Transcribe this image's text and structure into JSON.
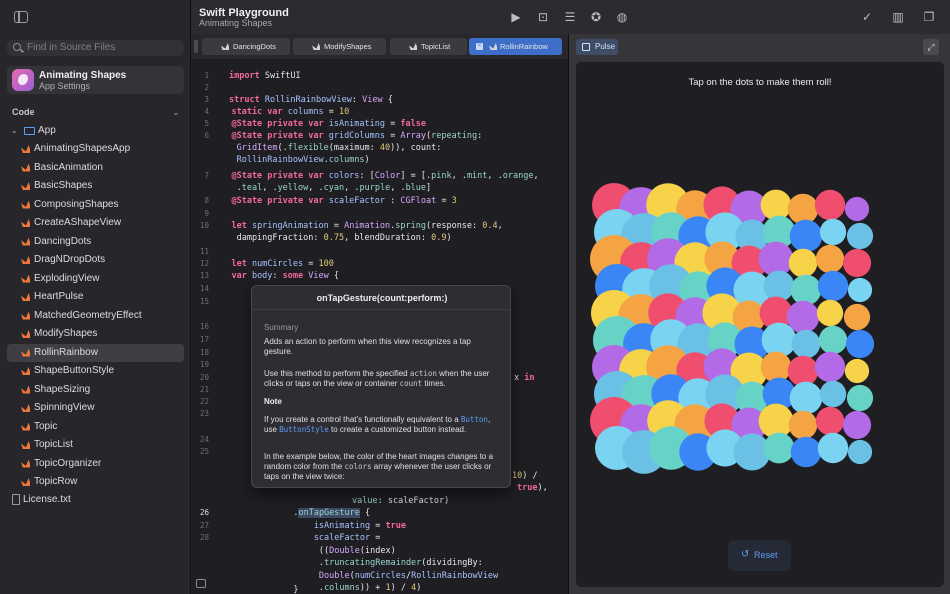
{
  "sidebar": {
    "search_placeholder": "Find in Source Files",
    "project": {
      "name": "Animating Shapes",
      "subtitle": "App Settings"
    },
    "section_label": "Code",
    "folder": "App",
    "files": [
      "AnimatingShapesApp",
      "BasicAnimation",
      "BasicShapes",
      "ComposingShapes",
      "CreateAShapeView",
      "DancingDots",
      "DragNDropDots",
      "ExplodingView",
      "HeartPulse",
      "MatchedGeometryEffect",
      "ModifyShapes",
      "RollinRainbow",
      "ShapeButtonStyle",
      "ShapeSizing",
      "SpinningView",
      "Topic",
      "TopicList",
      "TopicOrganizer",
      "TopicRow"
    ],
    "selected_file": "RollinRainbow",
    "license": "License.txt"
  },
  "titlebar": {
    "title": "Swift Playground",
    "subtitle": "Animating Shapes"
  },
  "tabs": [
    "DancingDots",
    "ModifyShapes",
    "TopicList",
    "RollinRainbow"
  ],
  "code": {
    "l1": "1",
    "l2": "2",
    "l3": "3",
    "l4": "4",
    "l5": "5",
    "l6": "6",
    "l7": "7",
    "l8": "8",
    "l9": "9",
    "l10": "10",
    "l11": "11",
    "l12": "12",
    "l13": "13",
    "l14": "14",
    "l15": "15",
    "l16": "16",
    "l17": "17",
    "l18": "18",
    "l19": "19",
    "l20": "20",
    "l21": "21",
    "l22": "22",
    "l23": "23",
    "l24": "24",
    "l25": "25",
    "l26": "26",
    "l27": "27",
    "l28": "28",
    "t1a": "import",
    "t1b": " SwiftUI",
    "t3a": "struct",
    "t3b": " RollinRainbowView",
    "t3c": ": ",
    "t3d": "View",
    "t3e": " {",
    "t4a": "    static var",
    "t4b": " columns",
    "t4c": " = ",
    "t4d": "10",
    "t5a": "    @State private var",
    "t5b": " isAnimating",
    "t5c": " = ",
    "t5d": "false",
    "t6a": "    @State private var",
    "t6b": " gridColumns",
    "t6c": " = ",
    "t6d": "Array",
    "t6e": "(",
    "t6f": "repeating",
    "t6g": ":",
    "t6h": "     GridItem",
    "t6i": "(.",
    "t6j": "flexible",
    "t6k": "(maximum: ",
    "t6l": "40",
    "t6m": ")), count:",
    "t6n": "     RollinRainbowView",
    "t6o": ".",
    "t6p": "columns",
    "t6q": ")",
    "t7a": "    @State private var",
    "t7b": " colors",
    "t7c": ": [",
    "t7d": "Color",
    "t7e": "] = [.",
    "t7f": "pink",
    "t7g": ", .",
    "t7h": "mint",
    "t7i": ", .",
    "t7j": "orange",
    "t7k": ",",
    "t7l": "     .",
    "t7m": "teal",
    "t7n": ", .",
    "t7o": "yellow",
    "t7p": ", .",
    "t7q": "cyan",
    "t7r": ", .",
    "t7s": "purple",
    "t7t": ", .",
    "t7u": "blue",
    "t7v": "]",
    "t8a": "    @State private var",
    "t8b": " scaleFactor",
    "t8c": " : ",
    "t8d": "CGFloat",
    "t8e": " = ",
    "t8f": "3",
    "t10a": "    let",
    "t10b": " springAnimation",
    "t10c": " = ",
    "t10d": "Animation",
    "t10e": ".",
    "t10f": "spring",
    "t10g": "(response: ",
    "t10h": "0.4",
    "t10i": ",",
    "t10j": "     dampingFraction: ",
    "t10k": "0.75",
    "t10l": ", blendDuration: ",
    "t10m": "0.9",
    "t10n": ")",
    "t12a": "    let",
    "t12b": " numCircles",
    "t12c": " = ",
    "t12d": "100",
    "t13a": "    var",
    "t13b": " body",
    "t13c": ": ",
    "t13d": "some",
    "t13e": " View",
    "t13f": " {",
    "frag20": "x ",
    "frag20b": "in",
    "frag25a": "10",
    "frag25b": ") /",
    "frag25c": "true",
    "frag25d": "),",
    "frag25e": "value",
    "frag25f": ": scaleFactor)",
    "t26a": "                    .",
    "t26b": "onTapGesture",
    "t26c": " {",
    "t27a": "                        isAnimating",
    "t27b": " = ",
    "t27c": "true",
    "t28a": "                        scaleFactor",
    "t28b": " =",
    "t28c": "                         ((",
    "t28d": "Double",
    "t28e": "(index)",
    "t28f": "                         .",
    "t28g": "truncatingRemainder",
    "t28h": "(dividingBy:",
    "t28i": "                         Double",
    "t28j": "(",
    "t28k": "numCircles",
    "t28l": "/",
    "t28m": "RollinRainbowView",
    "t28n": "                         .",
    "t28o": "columns",
    "t28p": ")) + ",
    "t28q": "1",
    "t28r": ") / ",
    "t28s": "4",
    "t28t": ")",
    "t29": "                    }"
  },
  "popover": {
    "title": "onTapGesture(count:perform:)",
    "summary_label": "Summary",
    "summary": "Adds an action to perform when this view recognizes a tap gesture.",
    "p1a": "Use this method to perform the specified ",
    "p1b": "action",
    "p1c": " when the user clicks or taps on the view or container ",
    "p1d": "count",
    "p1e": " times.",
    "note_label": "Note",
    "p2a": "If you create a control that’s functionally equivalent to a ",
    "p2b": "Button",
    "p2c": ", use ",
    "p2d": "ButtonStyle",
    "p2e": " to create a customized button instead.",
    "p3a": "In the example below, the color of the heart images changes to a random color from the ",
    "p3b": "colors",
    "p3c": " array whenever the user clicks or taps on the view twice:"
  },
  "preview": {
    "pulse_label": "Pulse",
    "instruction": "Tap on the dots to make them roll!",
    "reset_label": "Reset"
  },
  "colors": {
    "accent": "#3e6fc8",
    "pink": "#ef4e6f",
    "mint": "#67d3c7",
    "orange": "#f5a443",
    "teal": "#6ac1e5",
    "yellow": "#f6d349",
    "cyan": "#7ad3f0",
    "purple": "#b36ae6",
    "blue": "#3a86f6"
  },
  "dots_grid": {
    "rows": 10,
    "columns": 10
  }
}
